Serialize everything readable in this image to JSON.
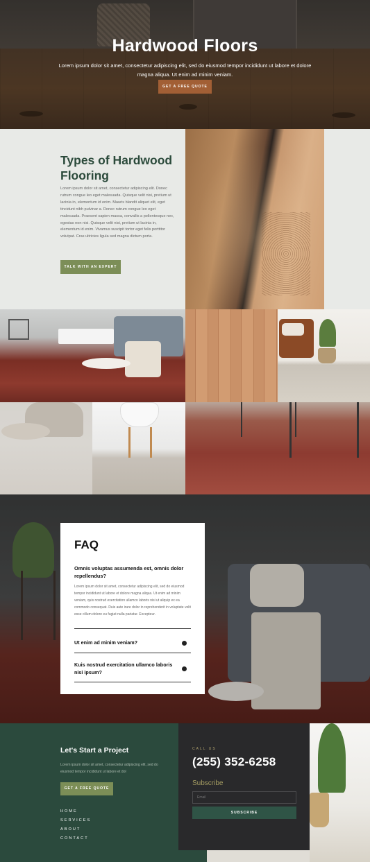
{
  "hero": {
    "title": "Hardwood Floors",
    "text": "Lorem ipsum dolor sit amet, consectetur adipiscing elit, sed do eiusmod tempor incididunt ut labore et dolore magna aliqua. Ut enim ad minim veniam.",
    "button": "Get a free quote"
  },
  "types": {
    "title": "Types of Hardwood Flooring",
    "text": "Lorem ipsum dolor sit amet, consectetur adipiscing elit. Donec rutrum congue leo eget malesuada. Quisque velit nisi, pretium ut lacinia in, elementum id enim. Mauris blandit aliquet elit, eget tincidunt nibh pulvinar a. Donec rutrum congue leo eget malesuada. Praesent sapien massa, convallis a pellentesque nec, egestas non nisi. Quisque velit nisi, pretium ut lacinia in, elementum id enim. Vivamus suscipit tortor eget felis porttitor volutpat. Cras ultricies ligula sed magna dictum porta.",
    "button": "Talk with an expert"
  },
  "faq": {
    "title": "FAQ",
    "items": [
      {
        "question": "Omnis voluptas assumenda est, omnis dolor repellendus?",
        "answer": "Lorem ipsum dolor sit amet, consectetur adipiscing elit, sed do eiusmod tempor incididunt ut labore et dolore magna aliqua. Ut enim ad minim veniam, quis nostrud exercitation ullamco laboris nisi ut aliquip ex ea commodo consequat. Duis aute irure dolor in reprehenderit in voluptate velit esse cillum dolore eu fugiat nulla pariatur. Excepteur."
      },
      {
        "question": "Ut enim ad minim veniam?"
      },
      {
        "question": "Kuis nostrud exercitation ullamco laboris nisi ipsum?"
      }
    ]
  },
  "footer": {
    "title": "Let's Start a Project",
    "text": "Lorem ipsum dolor sit amet, consectetur adipiscing elit, sed do eiusmod tempor incididunt ut labore et dol",
    "button": "Get a free quote",
    "nav": [
      "Home",
      "Services",
      "About",
      "Contact"
    ],
    "call_label": "Call us",
    "phone": "(255) 352-6258",
    "subscribe_title": "Subscribe",
    "email_placeholder": "Email",
    "subscribe_button": "Subscribe"
  },
  "colors": {
    "brand_green": "#2b4a3d",
    "olive": "#7c8e57",
    "copper": "#a25f35",
    "dark": "#29292b"
  }
}
